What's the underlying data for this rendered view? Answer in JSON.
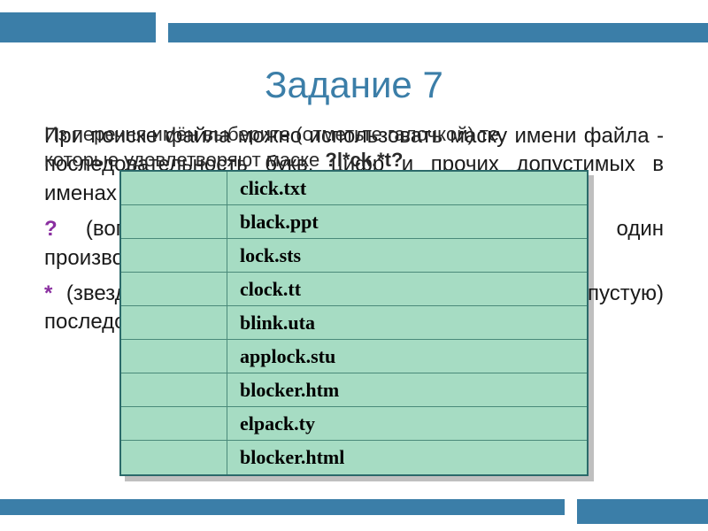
{
  "title": "Задание 7",
  "overlay": {
    "line1": "Из перечня имён выберите (отметьте галочкой) те,",
    "line2_prefix": "которые удовлетворяют маске ",
    "mask": "?l*ck.*t?"
  },
  "body": {
    "p1": "При поиске файла можно использовать маску имени файла - последовательность букв, цифр и прочих допустимых в именах файлов символов, в том числе:",
    "p2_sym": "?",
    "p2_rest": " (вопросительный знак) — означает ровно один произвольный символ.",
    "p3_sym": "*",
    "p3_rest": " (звездочка) — означает любую (в том числе и пустую) последовательность символов."
  },
  "files": [
    "click.txt",
    "black.ppt",
    "lock.sts",
    "clock.tt",
    "blink.uta",
    "applock.stu",
    "blocker.htm",
    "elpack.ty",
    "blocker.html"
  ]
}
